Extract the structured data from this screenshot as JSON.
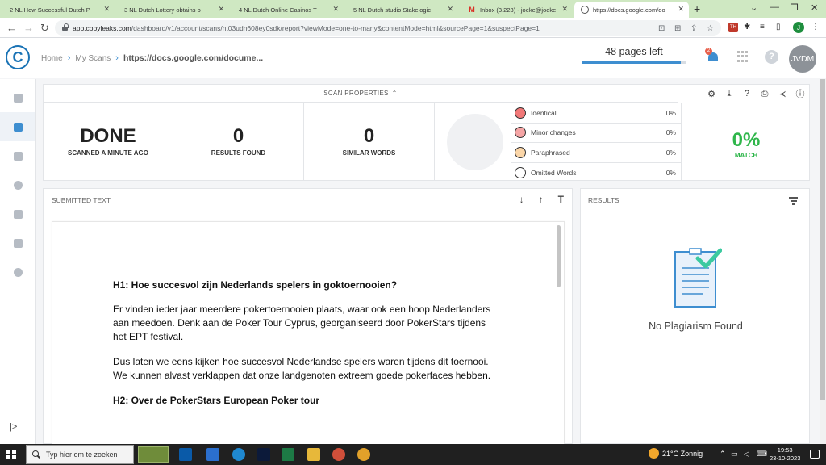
{
  "browser": {
    "tabs": [
      {
        "title": "2 NL How Successful Dutch P",
        "icon": "docs-icon"
      },
      {
        "title": "3 NL Dutch Lottery obtains o",
        "icon": "docs-icon"
      },
      {
        "title": "4 NL Dutch Online Casinos T",
        "icon": "docs-icon"
      },
      {
        "title": "5 NL Dutch studio Stakelogic",
        "icon": "docs-icon"
      },
      {
        "title": "Inbox (3.223) - joeke@joeke",
        "icon": "gmail-icon"
      },
      {
        "title": "https://docs.google.com/do",
        "icon": "copyleaks-icon"
      }
    ],
    "url_host": "app.copyleaks.com",
    "url_path": "/dashboard/v1/account/scans/nt03udn608ey0sdk/report?viewMode=one-to-many&contentMode=html&sourcePage=1&suspectPage=1",
    "profile_initial": "J",
    "ext_badge": "TH"
  },
  "header": {
    "breadcrumb": [
      "Home",
      "My Scans"
    ],
    "current": "https://docs.google.com/docume...",
    "pages_left": "48 pages left",
    "pages_left_fraction": 0.95,
    "notification_count": "2",
    "avatar": "JVDM"
  },
  "props": {
    "title": "SCAN PROPERTIES",
    "status": "DONE",
    "status_label": "SCANNED A MINUTE AGO",
    "results": "0",
    "results_label": "RESULTS FOUND",
    "similar": "0",
    "similar_label": "SIMILAR WORDS",
    "legend": [
      {
        "label": "Identical",
        "pct": "0%",
        "color": "#f17878"
      },
      {
        "label": "Minor changes",
        "pct": "0%",
        "color": "#f5a5a5"
      },
      {
        "label": "Paraphrased",
        "pct": "0%",
        "color": "#fbd6a8"
      },
      {
        "label": "Omitted Words",
        "pct": "0%",
        "color": "#ffffff"
      }
    ],
    "match_value": "0%",
    "match_label": "MATCH"
  },
  "submitted": {
    "title": "SUBMITTED TEXT",
    "h1": "H1: Hoe succesvol zijn Nederlands spelers in goktoernooien?",
    "p1": "Er vinden ieder jaar meerdere pokertoernooien plaats, waar ook een hoop Nederlanders aan meedoen. Denk aan de Poker Tour Cyprus, georganiseerd door PokerStars tijdens het EPT festival.",
    "p2": "Dus laten we eens kijken hoe succesvol Nederlandse spelers waren tijdens dit toernooi. We kunnen alvast verklappen dat onze landgenoten extreem goede pokerfaces hebben.",
    "h2": "H2: Over de PokerStars European Poker tour"
  },
  "results": {
    "title": "RESULTS",
    "empty_text": "No Plagiarism Found"
  },
  "taskbar": {
    "search_placeholder": "Typ hier om te zoeken",
    "weather": "21°C  Zonnig",
    "time": "19:53",
    "date": "23-10-2023"
  }
}
